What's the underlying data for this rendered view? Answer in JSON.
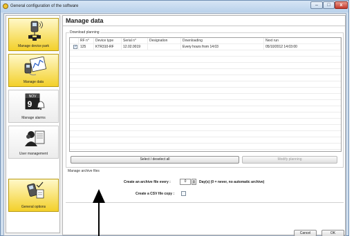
{
  "window": {
    "title": "General configuration of the software",
    "minimize_glyph": "–",
    "maximize_glyph": "□",
    "close_glyph": "x"
  },
  "sidebar": {
    "items": [
      {
        "label": "Manage device park",
        "icon": "device-network-icon",
        "active": true
      },
      {
        "label": "Manage data",
        "icon": "data-chart-icon",
        "active": true
      },
      {
        "label": "Manage alarms",
        "icon": "calendar-alarm-icon",
        "active": false
      },
      {
        "label": "User management",
        "icon": "user-document-icon",
        "active": false
      },
      {
        "label": "General options",
        "icon": "device-options-icon",
        "active": true
      }
    ],
    "calendar_month": "NOV",
    "calendar_day": "9"
  },
  "main": {
    "title": "Manage data",
    "download_planning": {
      "group_label": "Download planning",
      "columns": [
        "",
        "RF n°",
        "Device type",
        "Serial n°",
        "Designation",
        "Downloading",
        "Next run"
      ],
      "rows": [
        {
          "checked": true,
          "check_glyph": "✓",
          "rf": "125",
          "device_type": "KTR310-RF",
          "serial": "12.02.0019",
          "designation": "",
          "downloading": "Every hours from 14:03",
          "next_run": "05/10/2012 14:03:00"
        }
      ],
      "select_button": "Select / deselect all",
      "modify_button": "Modify planning"
    },
    "archive": {
      "group_label": "Manage archive files",
      "create_every_label": "Create an archive file every :",
      "archive_value": "0",
      "spin_up": "▲",
      "spin_down": "▼",
      "days_note": "Day(s)  (0 = never, no automatic archive)",
      "csv_label": "Create a CSV file copy :",
      "csv_checked": false
    }
  },
  "footer": {
    "cancel": "Cancel",
    "ok": "OK"
  },
  "colors": {
    "active_item": "#f3d02a",
    "window_frame": "#cfdeee",
    "close_button": "#c4392b"
  }
}
